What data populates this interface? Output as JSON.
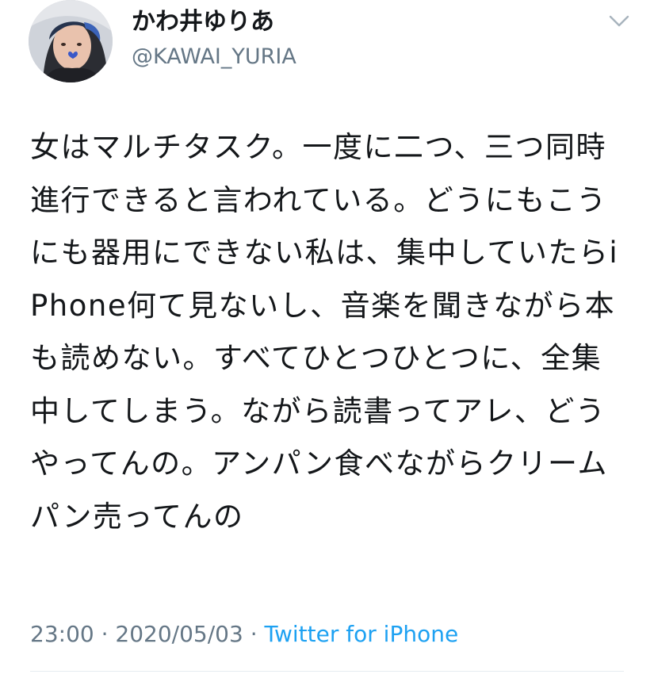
{
  "tweet": {
    "display_name": "かわ井ゆりあ",
    "handle": "@KAWAI_YURIA",
    "avatar_icon": "profile-photo-icon",
    "menu_icon": "chevron-down-icon",
    "text": "女はマルチタスク。一度に二つ、三つ同時進行できると言われている。どうにもこうにも器用にできない私は、集中していたらiPhone何て見ないし、音楽を聞きながら本も読めない。すべてひとつひとつに、全集中してしまう。ながら読書ってアレ、どうやってんの。アンパン食べながらクリームパン売ってんの",
    "time": "23:00",
    "separator": "·",
    "date": "2020/05/03",
    "source": "Twitter for iPhone"
  },
  "colors": {
    "text": "#14171a",
    "muted": "#657786",
    "link": "#1da1f2",
    "divider": "#e6ecf0"
  }
}
